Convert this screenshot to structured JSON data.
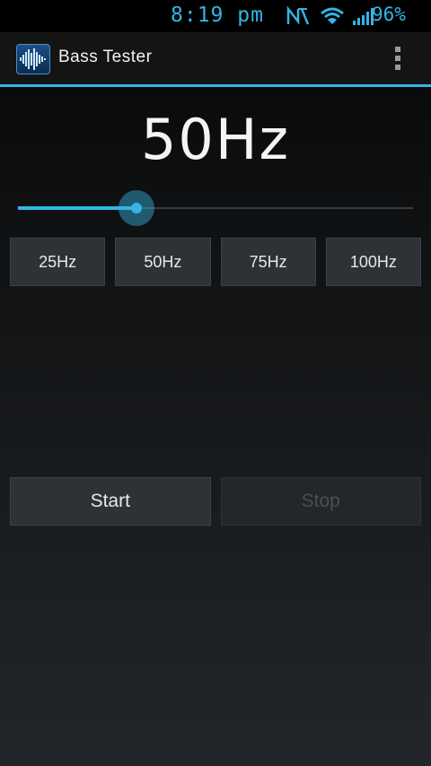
{
  "status_bar": {
    "time": "8:19 pm",
    "battery": "96%",
    "icons": [
      "nfc-icon",
      "wifi-icon",
      "signal-icon"
    ]
  },
  "action_bar": {
    "title": "Bass Tester",
    "app_icon": "waveform-icon",
    "overflow_icon": "overflow-menu-icon"
  },
  "frequency": {
    "display": "50Hz",
    "slider_level": 0.3
  },
  "presets": [
    {
      "label": "25Hz"
    },
    {
      "label": "50Hz"
    },
    {
      "label": "75Hz"
    },
    {
      "label": "100Hz"
    }
  ],
  "controls": {
    "start_label": "Start",
    "stop_label": "Stop"
  },
  "colors": {
    "accent": "#33b5e5",
    "button_bg": "#2e3236",
    "disabled_text": "#4a4e52"
  }
}
